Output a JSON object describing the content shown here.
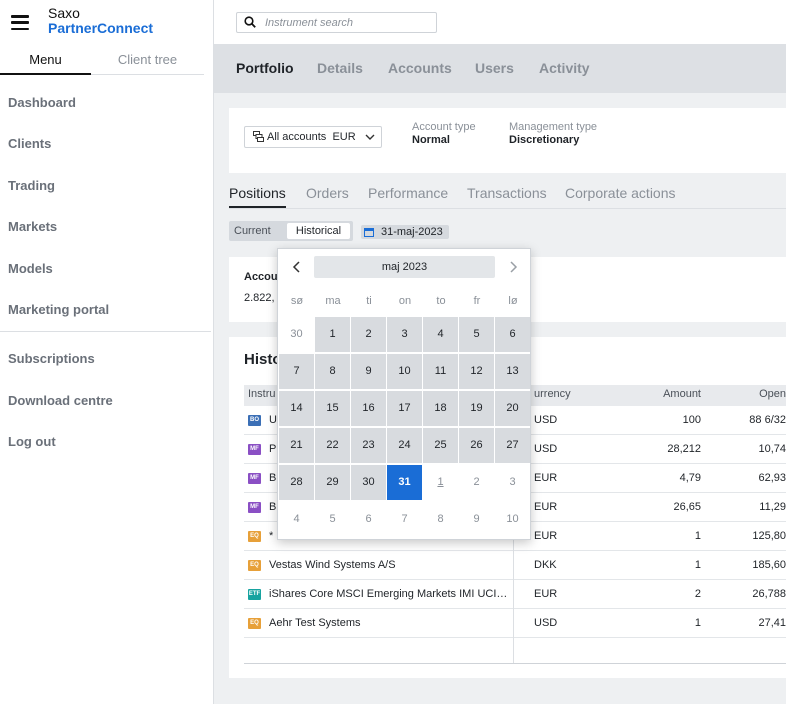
{
  "brand": {
    "line1": "Saxo",
    "line2": "PartnerConnect"
  },
  "sidebar": {
    "tabs": [
      "Menu",
      "Client tree"
    ],
    "items": [
      {
        "label": "Dashboard"
      },
      {
        "label": "Clients"
      },
      {
        "label": "Trading"
      },
      {
        "label": "Markets"
      },
      {
        "label": "Models"
      },
      {
        "label": "Marketing portal"
      },
      {
        "label": "Subscriptions"
      },
      {
        "label": "Download centre"
      },
      {
        "label": "Log out"
      }
    ]
  },
  "search": {
    "placeholder": "Instrument search"
  },
  "top_tabs": [
    "Portfolio",
    "Details",
    "Accounts",
    "Users",
    "Activity"
  ],
  "account": {
    "selector": "All accounts",
    "currency": "EUR",
    "type_label": "Account type",
    "type_value": "Normal",
    "mgmt_label": "Management type",
    "mgmt_value": "Discretionary"
  },
  "sub_tabs": [
    "Positions",
    "Orders",
    "Performance",
    "Transactions",
    "Corporate actions"
  ],
  "view_toggle": {
    "current": "Current",
    "historical": "Historical"
  },
  "date_chip": "31-maj-2023",
  "summary": {
    "label": "Accou",
    "value": "2.822,"
  },
  "holdings": {
    "title": "Histo",
    "columns": {
      "instrument": "Instru",
      "currency": "urrency",
      "amount": "Amount",
      "open": "Open"
    },
    "rows": [
      {
        "type": "BO",
        "name": "U",
        "currency": "USD",
        "amount": "100",
        "open": "88 6/32"
      },
      {
        "type": "MF",
        "name": "P",
        "currency": "USD",
        "amount": "28,212",
        "open": "10,74"
      },
      {
        "type": "MF",
        "name": "B",
        "currency": "EUR",
        "amount": "4,79",
        "open": "62,93"
      },
      {
        "type": "MF",
        "name": "B",
        "currency": "EUR",
        "amount": "26,65",
        "open": "11,29"
      },
      {
        "type": "EQ",
        "name": "*",
        "currency": "EUR",
        "amount": "1",
        "open": "125,80"
      },
      {
        "type": "EQ",
        "name": "Vestas Wind Systems A/S",
        "currency": "DKK",
        "amount": "1",
        "open": "185,60"
      },
      {
        "type": "ETF",
        "name": "iShares Core MSCI Emerging Markets IMI UCITS ETF",
        "currency": "EUR",
        "amount": "2",
        "open": "26,788"
      },
      {
        "type": "EQ",
        "name": "Aehr Test Systems",
        "currency": "USD",
        "amount": "1",
        "open": "27,41"
      }
    ]
  },
  "datepicker": {
    "month_label": "maj 2023",
    "weekdays": [
      "sø",
      "ma",
      "ti",
      "on",
      "to",
      "fr",
      "lø"
    ],
    "weeks": [
      [
        {
          "d": "30",
          "s": "out"
        },
        {
          "d": "1",
          "s": "in"
        },
        {
          "d": "2",
          "s": "in"
        },
        {
          "d": "3",
          "s": "in"
        },
        {
          "d": "4",
          "s": "in"
        },
        {
          "d": "5",
          "s": "in"
        },
        {
          "d": "6",
          "s": "in"
        }
      ],
      [
        {
          "d": "7",
          "s": "in"
        },
        {
          "d": "8",
          "s": "in"
        },
        {
          "d": "9",
          "s": "in"
        },
        {
          "d": "10",
          "s": "in"
        },
        {
          "d": "11",
          "s": "in"
        },
        {
          "d": "12",
          "s": "in"
        },
        {
          "d": "13",
          "s": "in"
        }
      ],
      [
        {
          "d": "14",
          "s": "in"
        },
        {
          "d": "15",
          "s": "in"
        },
        {
          "d": "16",
          "s": "in"
        },
        {
          "d": "17",
          "s": "in"
        },
        {
          "d": "18",
          "s": "in"
        },
        {
          "d": "19",
          "s": "in"
        },
        {
          "d": "20",
          "s": "in"
        }
      ],
      [
        {
          "d": "21",
          "s": "in"
        },
        {
          "d": "22",
          "s": "in"
        },
        {
          "d": "23",
          "s": "in"
        },
        {
          "d": "24",
          "s": "in"
        },
        {
          "d": "25",
          "s": "in"
        },
        {
          "d": "26",
          "s": "in"
        },
        {
          "d": "27",
          "s": "in"
        }
      ],
      [
        {
          "d": "28",
          "s": "in"
        },
        {
          "d": "29",
          "s": "in"
        },
        {
          "d": "30",
          "s": "in"
        },
        {
          "d": "31",
          "s": "sel"
        },
        {
          "d": "1",
          "s": "today"
        },
        {
          "d": "2",
          "s": "out"
        },
        {
          "d": "3",
          "s": "out"
        }
      ],
      [
        {
          "d": "4",
          "s": "out"
        },
        {
          "d": "5",
          "s": "out"
        },
        {
          "d": "6",
          "s": "out"
        },
        {
          "d": "7",
          "s": "out"
        },
        {
          "d": "8",
          "s": "out"
        },
        {
          "d": "9",
          "s": "out"
        },
        {
          "d": "10",
          "s": "out"
        }
      ]
    ]
  },
  "colors": {
    "brand_blue": "#1a6dd6",
    "selected_day": "#1a6dd6"
  }
}
